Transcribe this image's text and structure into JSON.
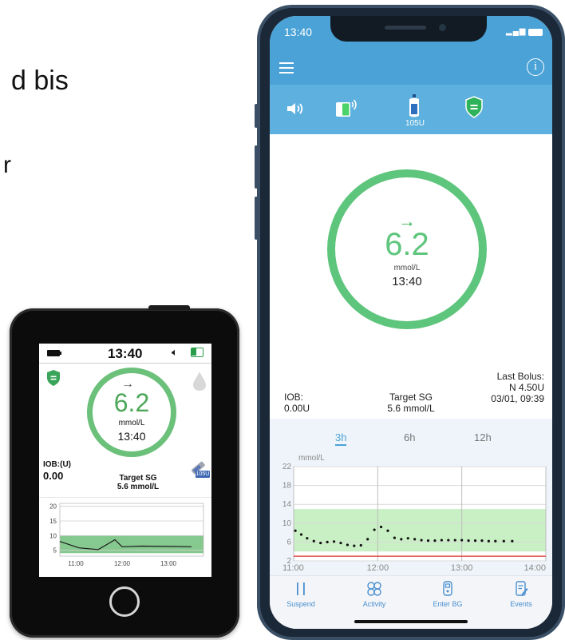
{
  "background": {
    "text_1": "d bis",
    "text_2": "r"
  },
  "handheld": {
    "time": "13:40",
    "glucose_value": "6.2",
    "trend_arrow": "→",
    "unit": "mmol/L",
    "clock": "13:40",
    "iob_label": "IOB:(U)",
    "iob_value": "0.00",
    "target_label": "Target SG",
    "target_value": "5.6 mmol/L",
    "reservoir_label": "105U",
    "chart_data": {
      "type": "line",
      "x_ticks": [
        "11:00",
        "12:00",
        "13:00"
      ],
      "y_ticks": [
        5,
        10,
        15,
        20
      ],
      "ylim": [
        3,
        21
      ],
      "target_range": [
        4,
        10
      ],
      "series": [
        {
          "values": [
            [
              0,
              8.0
            ],
            [
              0.4,
              5.8
            ],
            [
              0.8,
              5.2
            ],
            [
              1.15,
              8.6
            ],
            [
              1.3,
              6.2
            ],
            [
              1.7,
              6.4
            ],
            [
              2.3,
              6.3
            ],
            [
              2.75,
              6.2
            ]
          ]
        }
      ]
    }
  },
  "phone": {
    "status_time": "13:40",
    "signal": "▂▄▆",
    "reservoir_label": "105U",
    "trend_arrow": "→",
    "glucose_value": "6.2",
    "unit": "mmol/L",
    "clock": "13:40",
    "iob_label": "IOB:",
    "iob_value": "0.00U",
    "target_label": "Target SG",
    "target_value": "5.6 mmol/L",
    "last_bolus_label": "Last Bolus:",
    "last_bolus_value": "N 4.50U",
    "last_bolus_date": "03/01, 09:39",
    "tabs": [
      "3h",
      "6h",
      "12h"
    ],
    "nav": [
      {
        "label": "Suspend",
        "icon": "pause-icon"
      },
      {
        "label": "Activity",
        "icon": "activity-icon"
      },
      {
        "label": "Enter BG",
        "icon": "blood-glucose-meter-icon"
      },
      {
        "label": "Events",
        "icon": "events-icon"
      }
    ],
    "colors": {
      "header": "#4aa2d6",
      "ring": "#5ec57c",
      "target_band": "#c9f0c4",
      "low_line": "#e0302e"
    },
    "chart_data": {
      "type": "scatter",
      "ylabel": "mmol/L",
      "x_ticks": [
        "11:00",
        "12:00",
        "13:00",
        "14:00"
      ],
      "y_ticks": [
        2,
        6,
        10,
        14,
        18,
        22
      ],
      "ylim": [
        2,
        22
      ],
      "xlim": [
        0,
        3
      ],
      "target_range": [
        4,
        13
      ],
      "low_limit": 3,
      "points": [
        [
          0.02,
          8.4
        ],
        [
          0.09,
          7.6
        ],
        [
          0.16,
          6.8
        ],
        [
          0.24,
          6.2
        ],
        [
          0.32,
          5.8
        ],
        [
          0.4,
          6.0
        ],
        [
          0.48,
          6.1
        ],
        [
          0.56,
          5.8
        ],
        [
          0.64,
          5.4
        ],
        [
          0.72,
          5.2
        ],
        [
          0.8,
          5.3
        ],
        [
          0.88,
          6.6
        ],
        [
          0.96,
          8.6
        ],
        [
          1.04,
          9.2
        ],
        [
          1.12,
          8.4
        ],
        [
          1.2,
          6.9
        ],
        [
          1.28,
          6.6
        ],
        [
          1.36,
          6.8
        ],
        [
          1.44,
          6.6
        ],
        [
          1.52,
          6.4
        ],
        [
          1.6,
          6.3
        ],
        [
          1.68,
          6.3
        ],
        [
          1.76,
          6.4
        ],
        [
          1.84,
          6.4
        ],
        [
          1.92,
          6.4
        ],
        [
          2.0,
          6.4
        ],
        [
          2.08,
          6.3
        ],
        [
          2.16,
          6.3
        ],
        [
          2.24,
          6.3
        ],
        [
          2.32,
          6.2
        ],
        [
          2.4,
          6.2
        ],
        [
          2.5,
          6.2
        ],
        [
          2.6,
          6.2
        ]
      ]
    }
  }
}
